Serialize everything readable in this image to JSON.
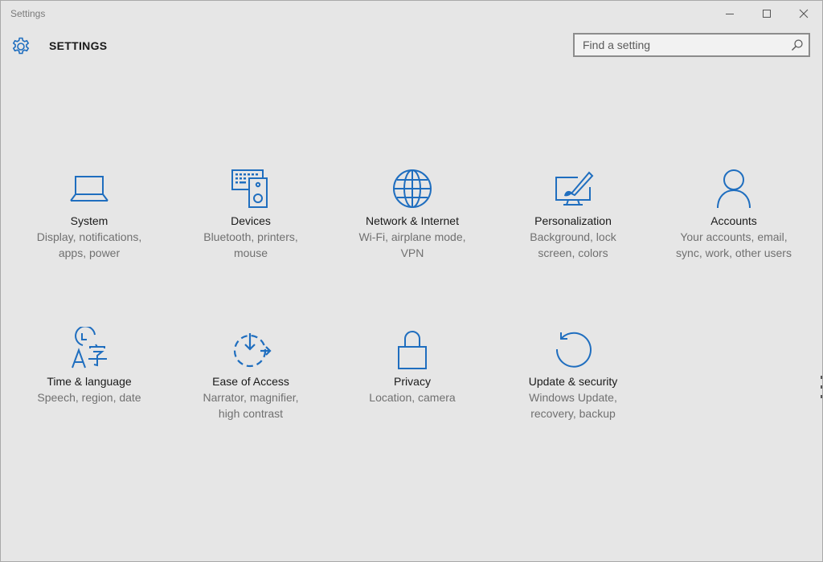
{
  "window": {
    "title": "Settings"
  },
  "header": {
    "title": "SETTINGS",
    "icon": "gear-icon"
  },
  "search": {
    "placeholder": "Find a setting",
    "value": ""
  },
  "colors": {
    "accent": "#1f6ebf",
    "background": "#e6e6e6",
    "title_text": "#1a1a1a",
    "desc_text": "#707070"
  },
  "categories": [
    {
      "title": "System",
      "desc": [
        "Display, notifications,",
        "apps, power"
      ],
      "icon": "laptop-icon"
    },
    {
      "title": "Devices",
      "desc": [
        "Bluetooth, printers,",
        "mouse"
      ],
      "icon": "devices-icon"
    },
    {
      "title": "Network & Internet",
      "desc": [
        "Wi-Fi, airplane mode,",
        "VPN"
      ],
      "icon": "globe-icon"
    },
    {
      "title": "Personalization",
      "desc": [
        "Background, lock",
        "screen, colors"
      ],
      "icon": "paintbrush-icon"
    },
    {
      "title": "Accounts",
      "desc": [
        "Your accounts, email,",
        "sync, work, other users"
      ],
      "icon": "person-icon"
    },
    {
      "title": "Time & language",
      "desc": [
        "Speech, region, date"
      ],
      "icon": "time-language-icon"
    },
    {
      "title": "Ease of Access",
      "desc": [
        "Narrator, magnifier,",
        "high contrast"
      ],
      "icon": "ease-of-access-icon"
    },
    {
      "title": "Privacy",
      "desc": [
        "Location, camera"
      ],
      "icon": "lock-icon"
    },
    {
      "title": "Update & security",
      "desc": [
        "Windows Update,",
        "recovery, backup"
      ],
      "icon": "refresh-icon"
    }
  ]
}
